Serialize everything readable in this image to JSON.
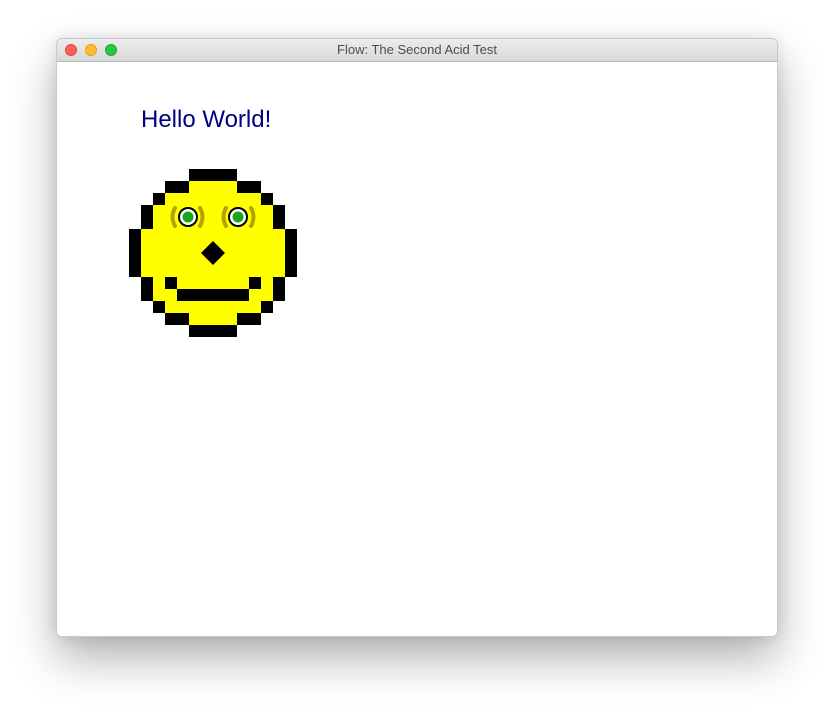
{
  "window": {
    "title": "Flow: The Second Acid Test",
    "controls": [
      "close",
      "minimize",
      "zoom"
    ]
  },
  "content": {
    "heading": "Hello World!",
    "smiley": {
      "face_color": "#ffff00",
      "outline_color": "#000000",
      "eye_color": "#1aa61a",
      "heading_color": "#000080"
    }
  }
}
